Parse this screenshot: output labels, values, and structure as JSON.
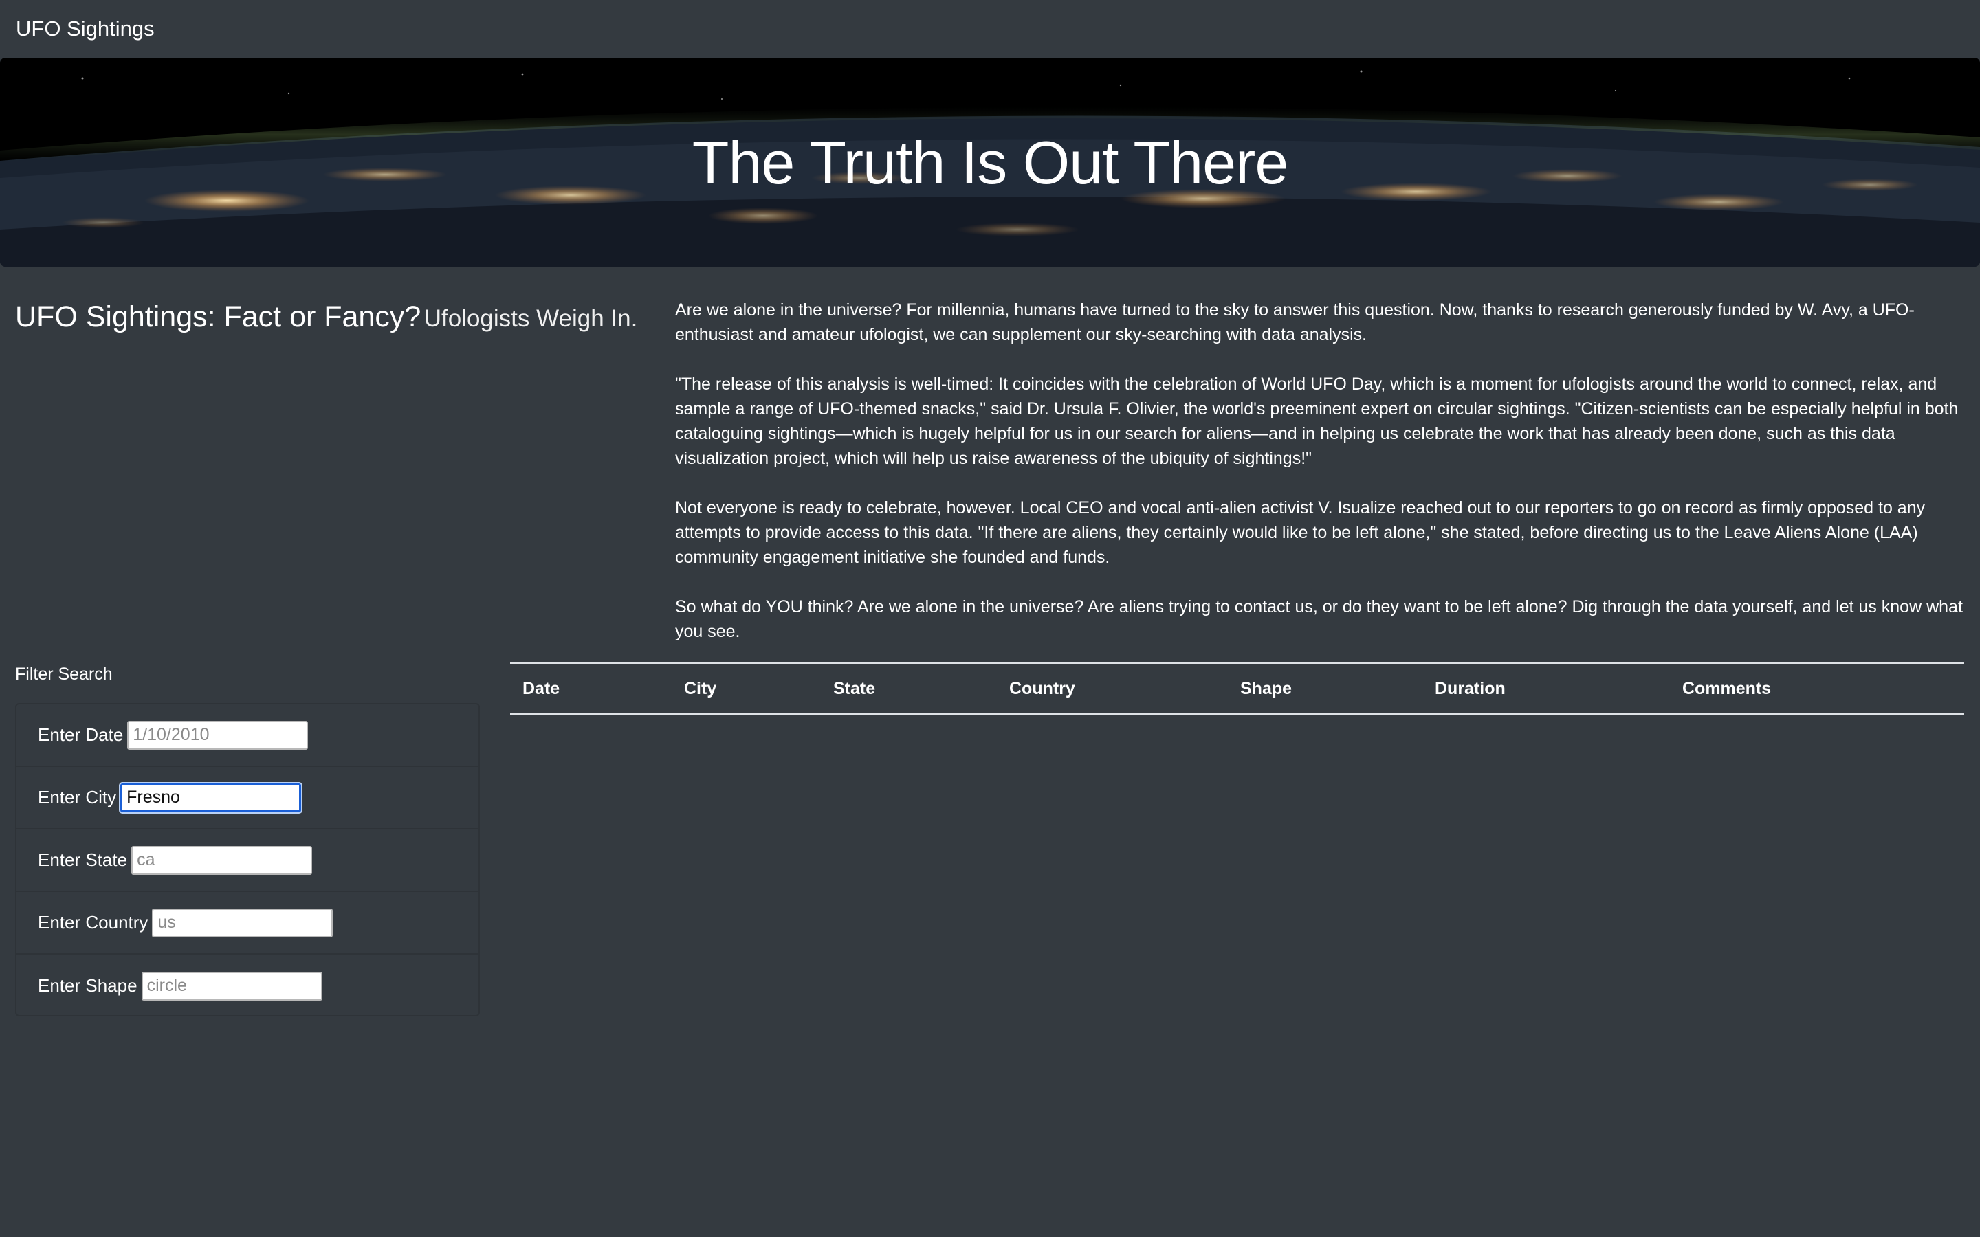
{
  "navbar": {
    "brand": "UFO Sightings"
  },
  "hero": {
    "title": "The Truth Is Out There"
  },
  "subhead": {
    "main": "UFO Sightings: Fact or Fancy?",
    "muted": "Ufologists Weigh In."
  },
  "article": {
    "paragraphs": [
      "Are we alone in the universe? For millennia, humans have turned to the sky to answer this question. Now, thanks to research generously funded by W. Avy, a UFO-enthusiast and amateur ufologist, we can supplement our sky-searching with data analysis.",
      "\"The release of this analysis is well-timed: It coincides with the celebration of World UFO Day, which is a moment for ufologists around the world to connect, relax, and sample a range of UFO-themed snacks,\" said Dr. Ursula F. Olivier, the world's preeminent expert on circular sightings. \"Citizen-scientists can be especially helpful in both cataloguing sightings—which is hugely helpful for us in our search for aliens—and in helping us celebrate the work that has already been done, such as this data visualization project, which will help us raise awareness of the ubiquity of sightings!\"",
      "Not everyone is ready to celebrate, however. Local CEO and vocal anti-alien activist V. Isualize reached out to our reporters to go on record as firmly opposed to any attempts to provide access to this data. \"If there are aliens, they certainly would like to be left alone,\" she stated, before directing us to the Leave Aliens Alone (LAA) community engagement initiative she founded and funds.",
      "So what do YOU think? Are we alone in the universe? Are aliens trying to contact us, or do they want to be left alone? Dig through the data yourself, and let us know what you see."
    ]
  },
  "filters": {
    "title": "Filter Search",
    "items": [
      {
        "label": "Enter Date",
        "value": "",
        "placeholder": "1/10/2010"
      },
      {
        "label": "Enter City",
        "value": "Fresno",
        "placeholder": ""
      },
      {
        "label": "Enter State",
        "value": "",
        "placeholder": "ca"
      },
      {
        "label": "Enter Country",
        "value": "",
        "placeholder": "us"
      },
      {
        "label": "Enter Shape",
        "value": "",
        "placeholder": "circle"
      }
    ]
  },
  "table": {
    "columns": [
      "Date",
      "City",
      "State",
      "Country",
      "Shape",
      "Duration",
      "Comments"
    ]
  }
}
